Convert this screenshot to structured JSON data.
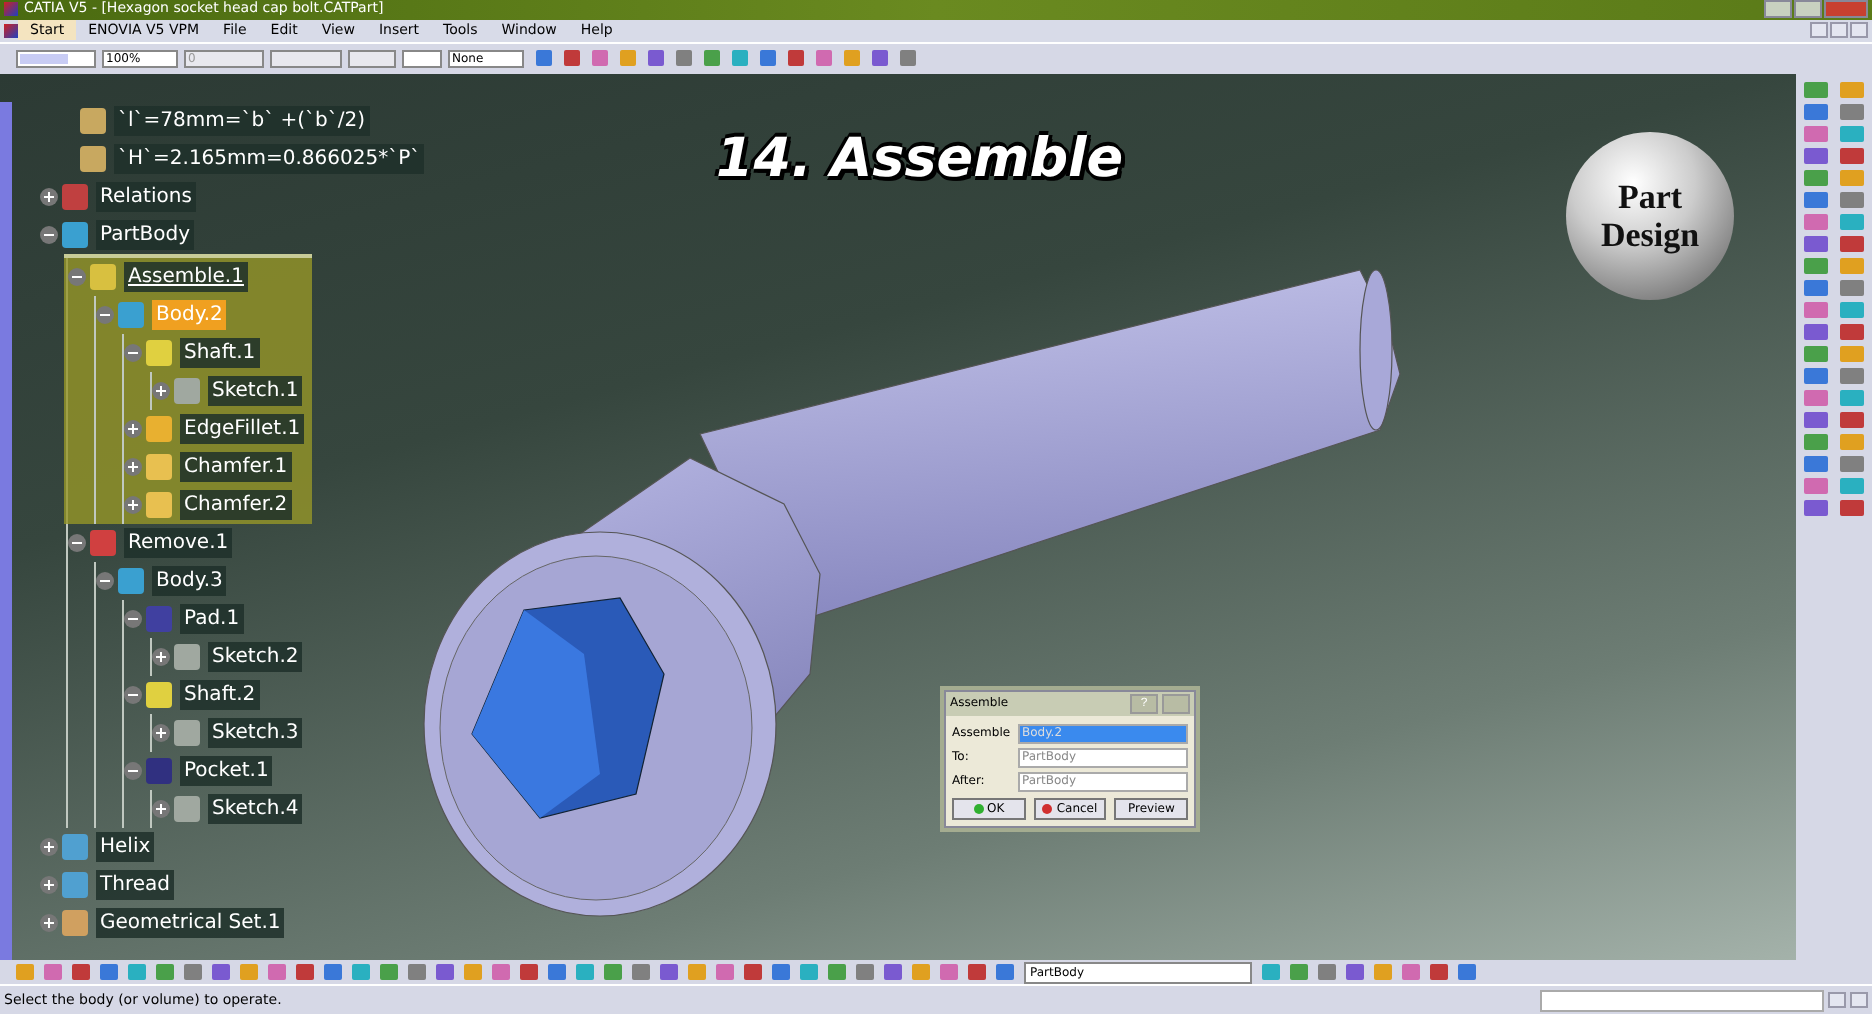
{
  "window": {
    "title": "CATIA V5 - [Hexagon socket head cap bolt.CATPart]"
  },
  "menu": [
    {
      "label": "Start",
      "highlighted": true
    },
    {
      "label": "ENOVIA V5 VPM",
      "highlighted": false
    },
    {
      "label": "File",
      "highlighted": false
    },
    {
      "label": "Edit",
      "highlighted": false
    },
    {
      "label": "View",
      "highlighted": false
    },
    {
      "label": "Insert",
      "highlighted": false
    },
    {
      "label": "Tools",
      "highlighted": false
    },
    {
      "label": "Window",
      "highlighted": false
    },
    {
      "label": "Help",
      "highlighted": false
    }
  ],
  "toolbar": {
    "zoom": "100%",
    "thickness": "0",
    "layer": "None"
  },
  "viewport": {
    "title": "14. Assemble",
    "badge": [
      "Part",
      "Design"
    ]
  },
  "tree": {
    "parameters": [
      {
        "label": "`l`=78mm=`b` +(`b`/2)"
      },
      {
        "label": "`H`=2.165mm=0.866025*`P`"
      }
    ],
    "items": [
      {
        "kind": "relations",
        "label": "Relations",
        "expanded": false,
        "selected": false,
        "highlighted": false
      },
      {
        "kind": "body",
        "label": "PartBody",
        "expanded": true,
        "selected": false,
        "highlighted": false,
        "children": [
          {
            "kind": "assemble",
            "label": "Assemble.1",
            "expanded": true,
            "selected": false,
            "highlighted": true,
            "children": [
              {
                "kind": "body",
                "label": "Body.2",
                "expanded": true,
                "selected": true,
                "highlighted": false,
                "children": [
                  {
                    "kind": "shaft",
                    "label": "Shaft.1",
                    "expanded": true,
                    "selected": false,
                    "highlighted": false,
                    "children": [
                      {
                        "kind": "sketch",
                        "label": "Sketch.1",
                        "expanded": false,
                        "selected": false,
                        "highlighted": false
                      }
                    ]
                  },
                  {
                    "kind": "fillet",
                    "label": "EdgeFillet.1",
                    "expanded": false,
                    "selected": false,
                    "highlighted": false
                  },
                  {
                    "kind": "chamfer",
                    "label": "Chamfer.1",
                    "expanded": false,
                    "selected": false,
                    "highlighted": false
                  },
                  {
                    "kind": "chamfer",
                    "label": "Chamfer.2",
                    "expanded": false,
                    "selected": false,
                    "highlighted": false
                  }
                ]
              }
            ]
          },
          {
            "kind": "remove",
            "label": "Remove.1",
            "expanded": true,
            "selected": false,
            "highlighted": false,
            "children": [
              {
                "kind": "body",
                "label": "Body.3",
                "expanded": true,
                "selected": false,
                "highlighted": false,
                "children": [
                  {
                    "kind": "pad",
                    "label": "Pad.1",
                    "expanded": true,
                    "selected": false,
                    "highlighted": false,
                    "children": [
                      {
                        "kind": "sketch",
                        "label": "Sketch.2",
                        "expanded": false,
                        "selected": false,
                        "highlighted": false
                      }
                    ]
                  },
                  {
                    "kind": "shaft",
                    "label": "Shaft.2",
                    "expanded": true,
                    "selected": false,
                    "highlighted": false,
                    "children": [
                      {
                        "kind": "sketch",
                        "label": "Sketch.3",
                        "expanded": false,
                        "selected": false,
                        "highlighted": false
                      }
                    ]
                  },
                  {
                    "kind": "pocket",
                    "label": "Pocket.1",
                    "expanded": true,
                    "selected": false,
                    "highlighted": false,
                    "children": [
                      {
                        "kind": "sketch",
                        "label": "Sketch.4",
                        "expanded": false,
                        "selected": false,
                        "highlighted": false
                      }
                    ]
                  }
                ]
              }
            ]
          }
        ]
      },
      {
        "kind": "helix",
        "label": "Helix",
        "expanded": false,
        "selected": false,
        "highlighted": false
      },
      {
        "kind": "helix",
        "label": "Thread",
        "expanded": false,
        "selected": false,
        "highlighted": false
      },
      {
        "kind": "geoset",
        "label": "Geometrical Set.1",
        "expanded": false,
        "selected": false,
        "highlighted": false
      }
    ]
  },
  "dialog": {
    "title": "Assemble",
    "help": "?",
    "fields": [
      {
        "label": "Assemble",
        "value": "Body.2",
        "selected": true
      },
      {
        "label": "To:",
        "value": "PartBody",
        "selected": false
      },
      {
        "label": "After:",
        "value": "PartBody",
        "selected": false
      }
    ],
    "buttons": [
      {
        "kind": "ok",
        "label": "OK"
      },
      {
        "kind": "cancel",
        "label": "Cancel"
      },
      {
        "kind": "plain",
        "label": "Preview"
      }
    ]
  },
  "bottom_toolbar": {
    "current_body": "PartBody"
  },
  "status_bar": {
    "message": "Select the body (or volume) to operate."
  }
}
